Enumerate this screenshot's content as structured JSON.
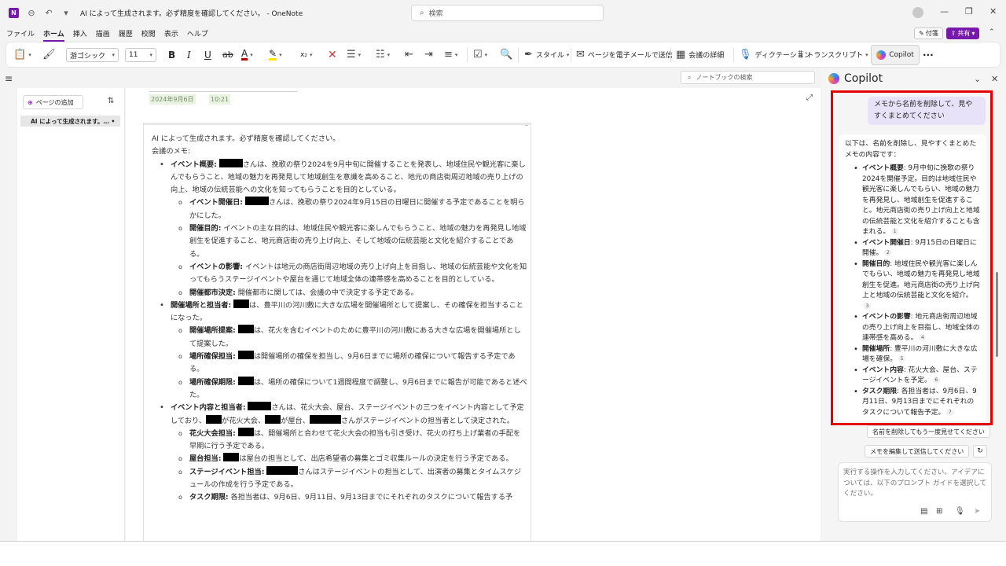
{
  "window": {
    "title": "AI によって生成されます。必ず精度を確認してください。 - OneNote",
    "app_logo": "N",
    "search_placeholder": "検索"
  },
  "menu": [
    "ファイル",
    "ホーム",
    "挿入",
    "描画",
    "履歴",
    "校閲",
    "表示",
    "ヘルプ"
  ],
  "menu_active": "ホーム",
  "header_buttons": {
    "fusen": "付箋",
    "share": "共有"
  },
  "ribbon": {
    "font_name": "游ゴシック",
    "font_size": "11",
    "bold": "B",
    "italic": "I",
    "underline": "U",
    "strike": "ab",
    "font_color_glyph": "A",
    "subscript": "x₂",
    "style": "スタイル",
    "email_page": "ページを電子メールで送信",
    "meeting_details": "会議の詳細",
    "dictation": "ディクテーション",
    "transcript": "トランスクリプト",
    "copilot": "Copilot",
    "more": "···"
  },
  "left_panel": {
    "add_page": "ページの追加",
    "page_entry": "AI によって生成されます。… •"
  },
  "notebook_search_placeholder": "ノートブックの検索",
  "page": {
    "date": "2024年9月6日",
    "time": "10:21",
    "intro": "AI によって生成されます。必ず精度を確認してください。",
    "memo_heading": "会議のメモ:",
    "sections": [
      {
        "title": "イベント概要:",
        "text_a": "さんは、挽歌の祭り2024を9月中旬に開催することを発表し、地域住民や観光客に楽しんでもらうこと、地域の魅力を再発見して地域創生を意識を高めること、地元の商店街周辺地域の売り上げの向上、地域の伝統芸能への文化を知ってもらうことを目的としている。",
        "items": [
          {
            "title": "イベント開催日:",
            "text": "さんは、挽歌の祭り2024年9月15日の日曜日に開催する予定であることを明らかにした。"
          },
          {
            "title": "開催目的:",
            "text": "イベントの主な目的は、地域住民や観光客に楽しんでもらうこと、地域の魅力を再発見し地域創生を促進すること、地元商店街の売り上げ向上、そして地域の伝統芸能と文化を紹介することである。"
          },
          {
            "title": "イベントの影響:",
            "text": "イベントは地元の商店街周辺地域の売り上げ向上を目指し、地域の伝統芸能や文化を知ってもらうステージイベントや屋台を通じて地域全体の連帯感を高めることを目的としている。"
          },
          {
            "title": "開催都市決定:",
            "text": "開催都市に関しては、会議の中で決定する予定である。"
          }
        ]
      },
      {
        "title": "開催場所と担当者:",
        "text_a": "は、豊平川の河川敷に大きな広場を開催場所として提案し、その確保を担当することになった。",
        "items": [
          {
            "title": "開催場所提案:",
            "text": "は、花火を含むイベントのために豊平川の河川敷にある大きな広場を開催場所として提案した。"
          },
          {
            "title": "場所確保担当:",
            "text": "は開催場所の確保を担当し、9月6日までに場所の確保について報告する予定である。"
          },
          {
            "title": "場所確保期限:",
            "text": "は、場所の確保について1週間程度で調整し、9月6日までに報告が可能であると述べた。"
          }
        ]
      },
      {
        "title": "イベント内容と担当者:",
        "text_a": "さんは、花火大会、屋台、ステージイベントの三つをイベント内容として予定しており、",
        "text_b": "が花火大会、",
        "text_c": "が屋台、",
        "text_d": "さんがステージイベントの担当者として決定された。",
        "items": [
          {
            "title": "花火大会担当:",
            "text": "は、開催場所と合わせて花火大会の担当も引き受け、花火の打ち上げ業者の手配を早期に行う予定である。"
          },
          {
            "title": "屋台担当:",
            "text": "は屋台の担当として、出店希望者の募集とゴミ収集ルールの決定を行う予定である。"
          },
          {
            "title": "ステージイベント担当:",
            "text": "さんはステージイベントの担当として、出演者の募集とタイムスケジュールの作成を行う予定である。"
          },
          {
            "title": "タスク期限:",
            "text": "各担当者は、9月6日、9月11日、9月13日までにそれぞれのタスクについて報告する予"
          }
        ]
      }
    ]
  },
  "copilot": {
    "title": "Copilot",
    "user_message": "メモから名前を削除して、見やすくまとめてください",
    "ai_intro": "以下は、名前を削除し、見やすくまとめたメモの内容です：",
    "ai_items": [
      {
        "title": "イベント概要",
        "text": ": 9月中旬に挽歌の祭り2024を開催予定。目的は地域住民や観光客に楽しんでもらい、地域の魅力を再発見し、地域創生を促進すること。地元商店街の売り上げ向上と地域の伝統芸能と文化を紹介することも含まれる。",
        "ref": "1"
      },
      {
        "title": "イベント開催日",
        "text": ": 9月15日の日曜日に開催。",
        "ref": "2"
      },
      {
        "title": "開催目的",
        "text": ": 地域住民や観光客に楽しんでもらい、地域の魅力を再発見し地域創生を促進。地元商店街の売り上げ向上と地域の伝統芸能と文化を紹介。",
        "ref": "3"
      },
      {
        "title": "イベントの影響",
        "text": ": 地元商店街周辺地域の売り上げ向上を目指し、地域全体の連帯感を高める。",
        "ref": "4"
      },
      {
        "title": "開催場所",
        "text": ": 豊平川の河川敷に大きな広場を確保。",
        "ref": "5"
      },
      {
        "title": "イベント内容",
        "text": ": 花火大会、屋台、ステージイベントを予定。",
        "ref": "6"
      },
      {
        "title": "タスク期限",
        "text": ": 各担当者は、9月6日、9月11日、9月13日までにそれぞれのタスクについて報告予定。",
        "ref": "7"
      }
    ],
    "suggestions": [
      "名前を削除してもう一度見せてください",
      "メモを編集して送信してください"
    ],
    "prompt_placeholder": "実行する操作を入力してください。アイデアについては、以下のプロンプト ガイドを選択してください。"
  }
}
